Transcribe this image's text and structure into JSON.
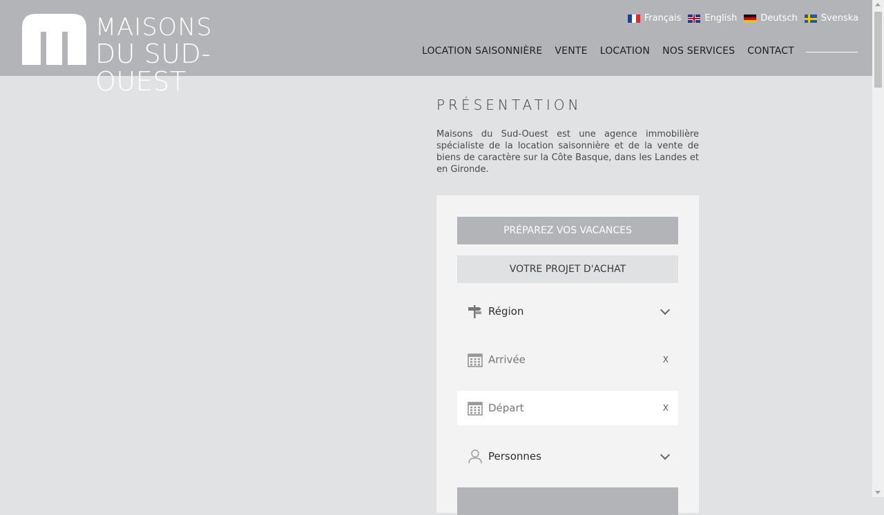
{
  "logo": {
    "line1": "MAISONS",
    "line2": "DU SUD-OUEST"
  },
  "languages": [
    {
      "label": "Français",
      "flag": "flag-fr"
    },
    {
      "label": "English",
      "flag": "flag-gb"
    },
    {
      "label": "Deutsch",
      "flag": "flag-de"
    },
    {
      "label": "Svenska",
      "flag": "flag-se"
    }
  ],
  "nav": [
    {
      "label": "LOCATION SAISONNIÈRE"
    },
    {
      "label": "VENTE"
    },
    {
      "label": "LOCATION"
    },
    {
      "label": "NOS SERVICES"
    },
    {
      "label": "CONTACT"
    }
  ],
  "presentation": {
    "title": "PRÉSENTATION",
    "text": "Maisons du Sud-Ouest est une agence immobilière spécialiste de la location saisonnière et de la vente de biens de caractère sur la Côte Basque, dans les Landes et en Gironde."
  },
  "search_panel": {
    "tab_vacances": "PRÉPAREZ VOS VACANCES",
    "tab_achat": "VOTRE PROJET D'ACHAT",
    "region": {
      "label": "Région",
      "icon": "signpost-icon"
    },
    "arrivee": {
      "placeholder": "Arrivée",
      "clear": "X",
      "icon": "calendar-icon"
    },
    "depart": {
      "placeholder": "Départ",
      "clear": "X",
      "icon": "calendar-icon"
    },
    "personnes": {
      "label": "Personnes",
      "icon": "person-icon"
    }
  },
  "colors": {
    "header_bg": "#b3b4b7",
    "page_bg": "#e1e2e4",
    "panel_bg": "#f3f3f3",
    "accent": "#b3b4b7"
  }
}
